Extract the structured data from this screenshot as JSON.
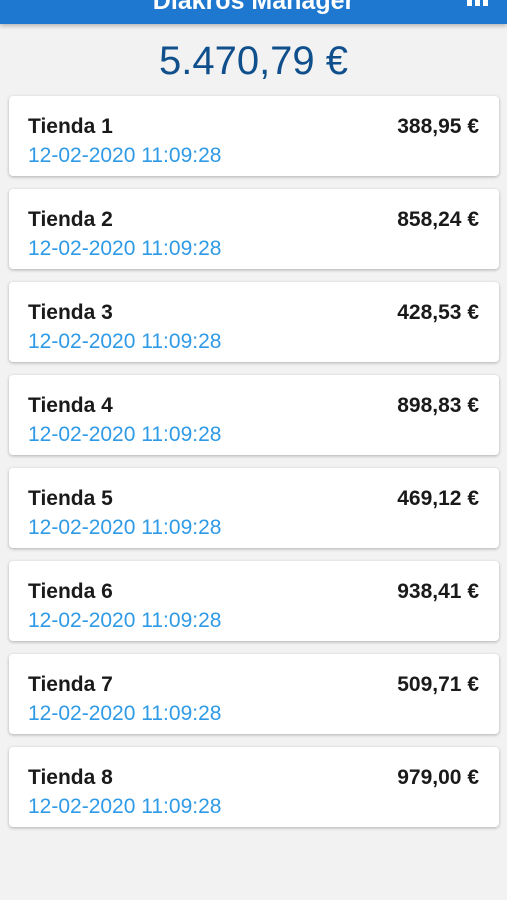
{
  "app": {
    "title": "Diakros Manager",
    "menu_icon": "bar-chart-icon",
    "accent_color": "#1e78d0"
  },
  "summary": {
    "total": "5.470,79 €"
  },
  "stores": [
    {
      "name": "Tienda 1",
      "amount": "388,95 €",
      "date": "12-02-2020 11:09:28"
    },
    {
      "name": "Tienda 2",
      "amount": "858,24 €",
      "date": "12-02-2020 11:09:28"
    },
    {
      "name": "Tienda 3",
      "amount": "428,53 €",
      "date": "12-02-2020 11:09:28"
    },
    {
      "name": "Tienda 4",
      "amount": "898,83 €",
      "date": "12-02-2020 11:09:28"
    },
    {
      "name": "Tienda 5",
      "amount": "469,12 €",
      "date": "12-02-2020 11:09:28"
    },
    {
      "name": "Tienda 6",
      "amount": "938,41 €",
      "date": "12-02-2020 11:09:28"
    },
    {
      "name": "Tienda 7",
      "amount": "509,71 €",
      "date": "12-02-2020 11:09:28"
    },
    {
      "name": "Tienda 8",
      "amount": "979,00 €",
      "date": "12-02-2020 11:09:28"
    }
  ]
}
